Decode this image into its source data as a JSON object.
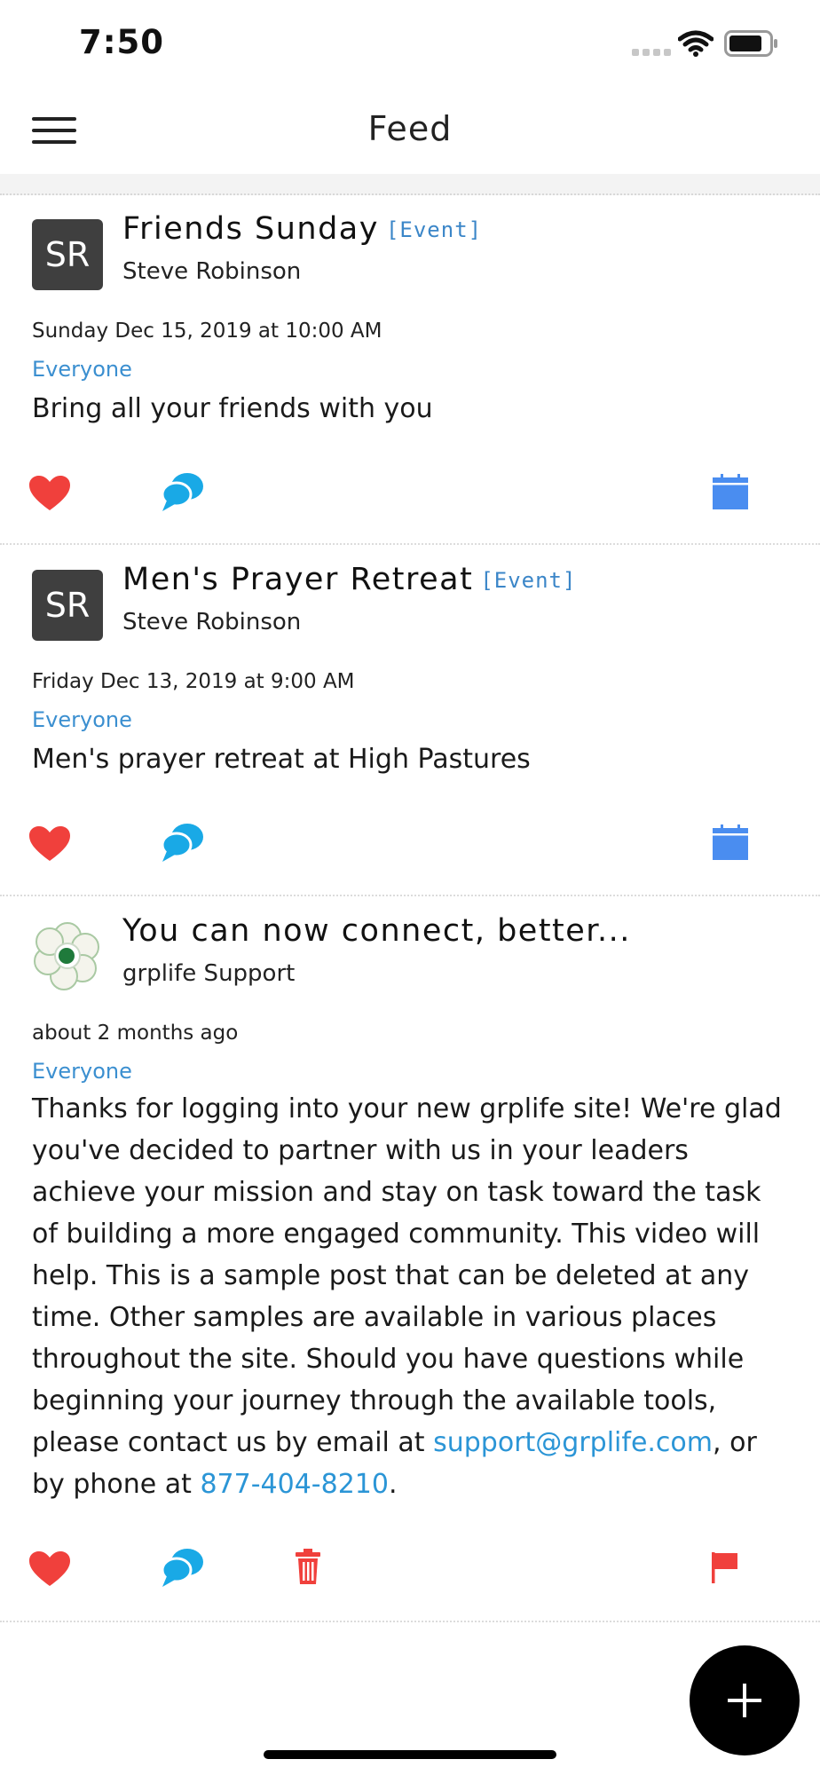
{
  "status_bar": {
    "time": "7:50"
  },
  "header": {
    "title": "Feed"
  },
  "posts": [
    {
      "avatar_initials": "SR",
      "title": "Friends Sunday",
      "tag": "[Event]",
      "author": "Steve Robinson",
      "date": "Sunday Dec 15, 2019 at 10:00 AM",
      "audience": "Everyone",
      "body": "Bring all your friends with you"
    },
    {
      "avatar_initials": "SR",
      "title": "Men's Prayer Retreat",
      "tag": "[Event]",
      "author": "Steve Robinson",
      "date": "Friday Dec 13, 2019 at 9:00 AM",
      "audience": "Everyone",
      "body": "Men's prayer retreat at High Pastures"
    },
    {
      "title": "You can now connect, better...",
      "author": "grplife Support",
      "date": "about 2 months ago",
      "audience": "Everyone",
      "body_text": "Thanks for logging into your new grplife site! We're glad you've decided to partner with us in your leaders achieve your mission and stay on task toward the task of building a more engaged community. This video will help. This is a sample post that can be deleted at any time. Other samples are available in various places throughout the site. Should you have questions while beginning your journey through the available tools, please contact us by email at ",
      "email": "support@grplife.com",
      "body_mid": ", or by phone at ",
      "phone": "877-404-8210",
      "body_end": "."
    }
  ],
  "icons": {
    "like": "heart-icon",
    "comment": "comment-icon",
    "calendar": "calendar-icon",
    "delete": "trash-icon",
    "report": "flag-icon",
    "compose": "plus-icon"
  },
  "colors": {
    "like": "#f0403c",
    "comment": "#19a9e6",
    "calendar": "#4a8df0",
    "delete": "#f0403c",
    "report": "#f0403c",
    "link": "#2b95d6",
    "audience": "#3b8fd0"
  }
}
